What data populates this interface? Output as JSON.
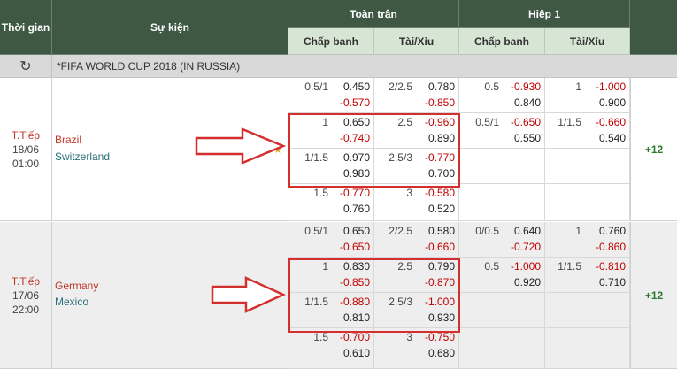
{
  "header": {
    "time": "Thời gian",
    "event": "Sự kiện",
    "fulltime": "Toàn trận",
    "half1": "Hiệp 1",
    "handicap": "Chấp banh",
    "overunder": "Tài/Xỉu"
  },
  "league": {
    "name": "*FIFA WORLD CUP 2018 (IN RUSSIA)",
    "refresh_icon": "refresh-icon"
  },
  "matches": [
    {
      "status": "T.Tiếp",
      "date": "18/06",
      "time": "01:00",
      "home": "Brazil",
      "away": "Switzerland",
      "more": "+12",
      "rows": [
        {
          "ft_hdp": "0.5/1",
          "ft_hdp_h": "0.450",
          "ft_hdp_a": "-0.570",
          "ft_ou": "2/2.5",
          "ft_ou_o": "0.780",
          "ft_ou_u": "-0.850",
          "h1_hdp": "0.5",
          "h1_hdp_h": "-0.930",
          "h1_hdp_a": "0.840",
          "h1_ou": "1",
          "h1_ou_o": "-1.000",
          "h1_ou_u": "0.900"
        },
        {
          "ft_hdp": "1",
          "ft_hdp_h": "0.650",
          "ft_hdp_a": "-0.740",
          "ft_ou": "2.5",
          "ft_ou_o": "-0.960",
          "ft_ou_u": "0.890",
          "h1_hdp": "0.5/1",
          "h1_hdp_h": "-0.650",
          "h1_hdp_a": "0.550",
          "h1_ou": "1/1.5",
          "h1_ou_o": "-0.660",
          "h1_ou_u": "0.540"
        },
        {
          "ft_hdp": "1/1.5",
          "ft_hdp_h": "0.970",
          "ft_hdp_a": "0.980",
          "ft_ou": "2.5/3",
          "ft_ou_o": "-0.770",
          "ft_ou_u": "0.700",
          "h1_hdp": "",
          "h1_hdp_h": "",
          "h1_hdp_a": "",
          "h1_ou": "",
          "h1_ou_o": "",
          "h1_ou_u": ""
        },
        {
          "ft_hdp": "1.5",
          "ft_hdp_h": "-0.770",
          "ft_hdp_a": "0.760",
          "ft_ou": "3",
          "ft_ou_o": "-0.580",
          "ft_ou_u": "0.520",
          "h1_hdp": "",
          "h1_hdp_h": "",
          "h1_hdp_a": "",
          "h1_ou": "",
          "h1_ou_o": "",
          "h1_ou_u": ""
        }
      ]
    },
    {
      "status": "T.Tiếp",
      "date": "17/06",
      "time": "22:00",
      "home": "Germany",
      "away": "Mexico",
      "more": "+12",
      "rows": [
        {
          "ft_hdp": "0.5/1",
          "ft_hdp_h": "0.650",
          "ft_hdp_a": "-0.650",
          "ft_ou": "2/2.5",
          "ft_ou_o": "0.580",
          "ft_ou_u": "-0.660",
          "h1_hdp": "0/0.5",
          "h1_hdp_h": "0.640",
          "h1_hdp_a": "-0.720",
          "h1_ou": "1",
          "h1_ou_o": "0.760",
          "h1_ou_u": "-0.860"
        },
        {
          "ft_hdp": "1",
          "ft_hdp_h": "0.830",
          "ft_hdp_a": "-0.850",
          "ft_ou": "2.5",
          "ft_ou_o": "0.790",
          "ft_ou_u": "-0.870",
          "h1_hdp": "0.5",
          "h1_hdp_h": "-1.000",
          "h1_hdp_a": "0.920",
          "h1_ou": "1/1.5",
          "h1_ou_o": "-0.810",
          "h1_ou_u": "0.710"
        },
        {
          "ft_hdp": "1/1.5",
          "ft_hdp_h": "-0.880",
          "ft_hdp_a": "0.810",
          "ft_ou": "2.5/3",
          "ft_ou_o": "-1.000",
          "ft_ou_u": "0.930",
          "h1_hdp": "",
          "h1_hdp_h": "",
          "h1_hdp_a": "",
          "h1_ou": "",
          "h1_ou_o": "",
          "h1_ou_u": ""
        },
        {
          "ft_hdp": "1.5",
          "ft_hdp_h": "-0.700",
          "ft_hdp_a": "0.610",
          "ft_ou": "3",
          "ft_ou_o": "-0.750",
          "ft_ou_u": "0.680",
          "h1_hdp": "",
          "h1_hdp_h": "",
          "h1_hdp_a": "",
          "h1_ou": "",
          "h1_ou_o": "",
          "h1_ou_u": ""
        }
      ]
    }
  ],
  "colors": {
    "header_bg": "#3f5844",
    "subheader_bg": "#d7e6d4",
    "negative": "#c00000",
    "highlight": "#d32f2f"
  }
}
